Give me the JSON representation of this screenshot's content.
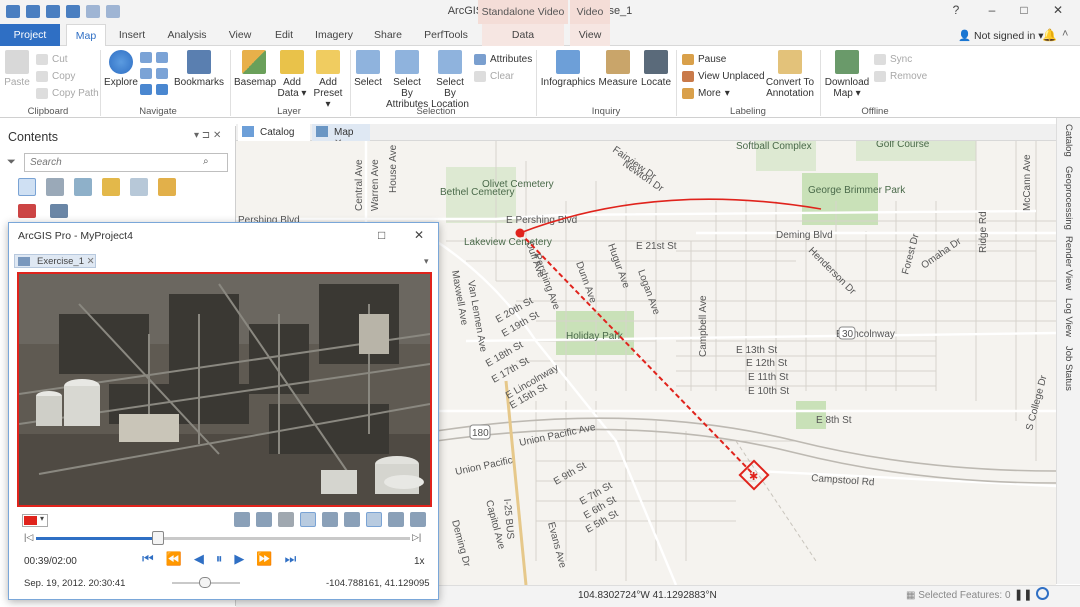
{
  "app": {
    "title": "ArcGIS Pro - MyProject4 - Exercise_1",
    "contextual_tabs": {
      "group1": "Standalone Video",
      "group2": "Video",
      "tab1": "Data",
      "tab2": "View"
    },
    "user": "Not signed in"
  },
  "tabs": [
    "Project",
    "Map",
    "Insert",
    "Analysis",
    "View",
    "Edit",
    "Imagery",
    "Share",
    "PerfTools"
  ],
  "ribbon": {
    "clipboard": {
      "paste": "Paste",
      "cut": "Cut",
      "copy": "Copy",
      "copy_path": "Copy Path",
      "group": "Clipboard"
    },
    "navigate": {
      "explore": "Explore",
      "bookmarks": "Bookmarks",
      "group": "Navigate"
    },
    "layer": {
      "basemap": "Basemap",
      "add_data_1": "Add",
      "add_data_2": "Data",
      "add_preset_1": "Add",
      "add_preset_2": "Preset",
      "group": "Layer"
    },
    "selection": {
      "select": "Select",
      "select_by_attr_1": "Select By",
      "select_by_attr_2": "Attributes",
      "select_by_loc_1": "Select By",
      "select_by_loc_2": "Location",
      "attributes": "Attributes",
      "clear": "Clear",
      "group": "Selection"
    },
    "inquiry": {
      "infographics": "Infographics",
      "measure": "Measure",
      "locate": "Locate",
      "group": "Inquiry"
    },
    "labeling": {
      "pause": "Pause",
      "view_unplaced": "View Unplaced",
      "more": "More",
      "convert_1": "Convert To",
      "convert_2": "Annotation",
      "group": "Labeling"
    },
    "offline": {
      "download_1": "Download",
      "download_2": "Map",
      "sync": "Sync",
      "remove": "Remove",
      "group": "Offline"
    }
  },
  "contents": {
    "title": "Contents",
    "search_placeholder": "Search"
  },
  "view_tabs": {
    "catalog": "Catalog",
    "map": "Map"
  },
  "right_rail": [
    "Catalog",
    "Geoprocessing",
    "Render View",
    "Log View",
    "Job Status"
  ],
  "map_labels": {
    "streets": [
      "E Pershing Blvd",
      "Pershing Blvd",
      "Deming Blvd",
      "E 21st St",
      "E 20th St",
      "E 19th St",
      "E 18th St",
      "E 17th St",
      "E Lincolnway",
      "E 15th St",
      "E 13th St",
      "E 12th St",
      "E 11th St",
      "E 10th St",
      "E 8th St",
      "Campstool Rd",
      "Union Pacific Ave",
      "E 9th St",
      "E 7th St",
      "E 6th St",
      "E 5th St",
      "E Lincolnway",
      "Central Ave",
      "Warren Ave",
      "House Ave",
      "Maxwell Ave",
      "Van Lennen Ave",
      "Duff Ave",
      "Pershing Ave",
      "Dunn Ave",
      "Hugur Ave",
      "Logan Ave",
      "Campbell Ave",
      "Henderson Dr",
      "Forest Dr",
      "Omaha Dr",
      "Ridge Rd",
      "McCann Ave",
      "S College Dr",
      "Fairview Dr",
      "Newton Dr",
      "Evans Ave",
      "Capitol Ave",
      "Deming Dr",
      "I-25 BUS"
    ],
    "places": [
      "Olivet Cemetery",
      "Bethel Cemetery",
      "Lakeview Cemetery",
      "Holiday Park",
      "George Brimmer Park",
      "Golf Course",
      "Softball Complex",
      "Union Pacific"
    ],
    "shields": [
      "30",
      "180"
    ]
  },
  "status": {
    "coordinates": "104.8302724°W 41.1292883°N",
    "selected": "Selected Features: 0"
  },
  "video_player": {
    "title": "ArcGIS Pro - MyProject4",
    "tab": "Exercise_1",
    "time": "00:39/02:00",
    "speed": "1x",
    "timestamp": "Sep. 19, 2012. 20:30:41",
    "location": "-104.788161, 41.129095",
    "progress": 0.325,
    "volume": 0.48,
    "color_swatch": "#e0231c"
  },
  "colors": {
    "accent": "#2f6fc4",
    "track": "#e0231c",
    "park": "#c9e1b8"
  }
}
